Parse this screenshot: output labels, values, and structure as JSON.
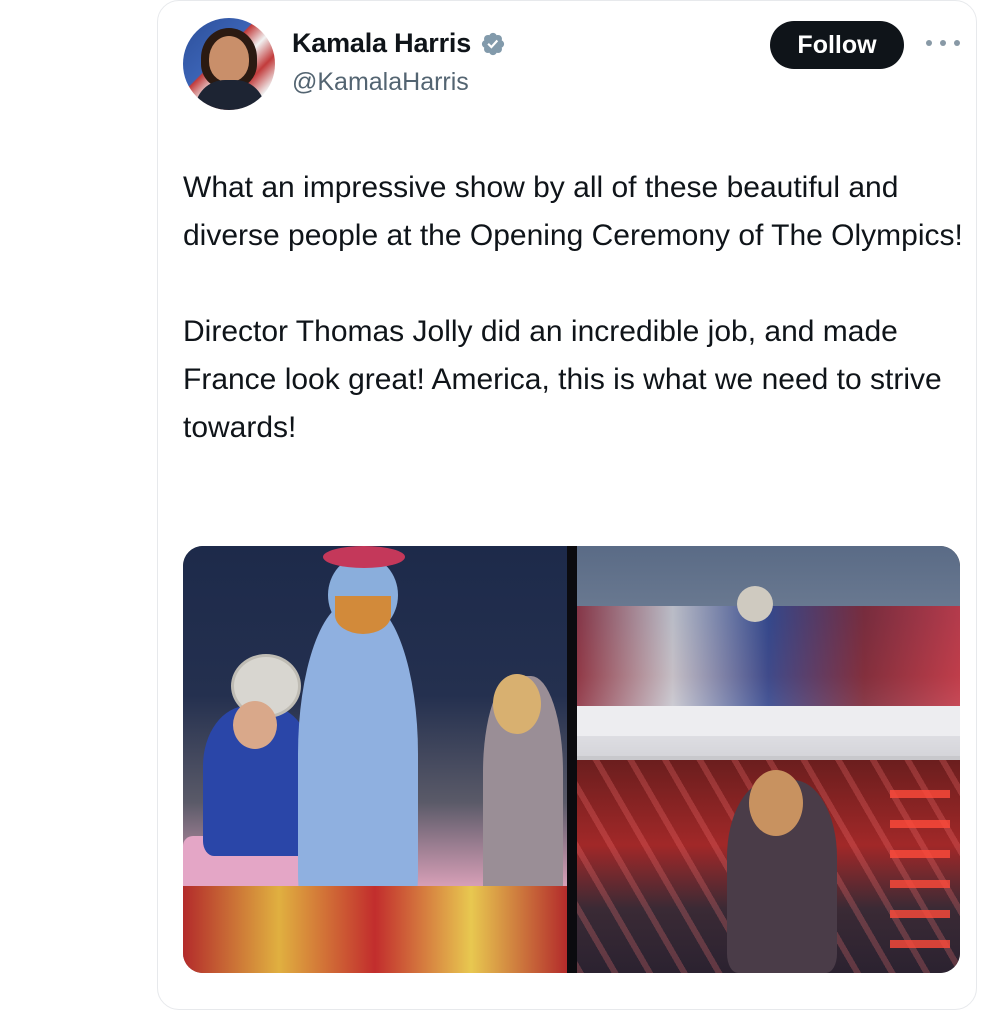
{
  "author": {
    "display_name": "Kamala Harris",
    "handle": "@KamalaHarris",
    "verified_icon": "verified-badge-icon",
    "avatar_icon": "profile-photo"
  },
  "actions": {
    "follow_label": "Follow",
    "more_icon": "more-options-icon"
  },
  "tweet": {
    "paragraphs": [
      "What an impressive show by all of these beautiful and diverse people at the Opening Ceremony of The Olympics!",
      "Director Thomas Jolly did an incredible job, and made France look great! America, this is what we need to strive towards!"
    ]
  },
  "media": {
    "photos": [
      "photo-left",
      "photo-right-top",
      "photo-right-bottom"
    ]
  },
  "colors": {
    "follow_bg": "#0f1419",
    "verified": "#829aab",
    "handle": "#536471"
  }
}
